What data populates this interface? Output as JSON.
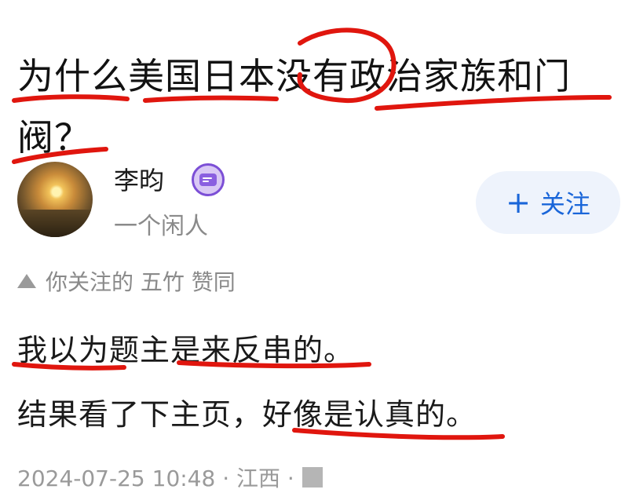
{
  "question": {
    "title": "为什么美国日本没有政治家族和门阀？"
  },
  "author": {
    "name": "李昀",
    "bio": "一个闲人",
    "badge_icon": "creator-badge-icon",
    "avatar_icon": "sunset-avatar"
  },
  "follow": {
    "plus": "+",
    "label": "关注"
  },
  "upvote": {
    "icon": "upvote-triangle-icon",
    "text": "你关注的 五竹 赞同"
  },
  "answer": {
    "line1": "我以为题主是来反串的。",
    "line2": "结果看了下主页，好像是认真的。"
  },
  "meta": {
    "text": "2024-07-25 10:48 · 江西 ·"
  },
  "colors": {
    "annotation_red": "#e0160e",
    "follow_blue": "#1a66d9",
    "follow_bg": "#eef3fc",
    "muted_gray": "#8a8a8a",
    "badge_purple": "#7c4fd6"
  }
}
